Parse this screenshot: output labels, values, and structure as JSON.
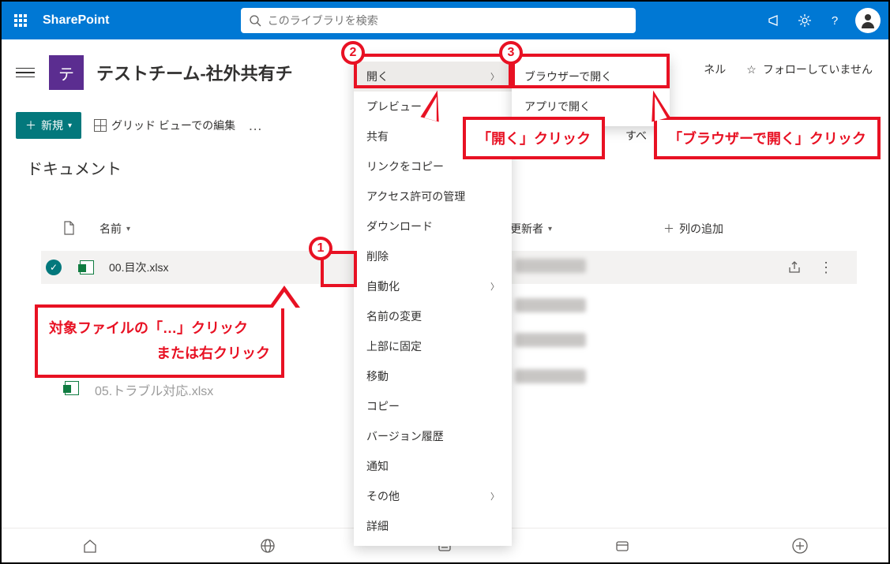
{
  "brand": "SharePoint",
  "search": {
    "placeholder": "このライブラリを検索"
  },
  "site": {
    "icon_letter": "テ",
    "name": "テストチーム-社外共有チ"
  },
  "follow": {
    "panel_suffix_label": "ネル",
    "label": "フォローしていません"
  },
  "toolbar": {
    "new_label": "新規",
    "grid_edit_label": "グリッド ビューでの編集",
    "more": "…"
  },
  "library_title": "ドキュメント",
  "columns": {
    "name": "名前",
    "modified_by": "更新者",
    "add_column": "列の追加"
  },
  "files": [
    {
      "name": "00.目次.xlsx"
    },
    {
      "name": "05.トラブル対応.xlsx"
    }
  ],
  "context_menu": {
    "open": "開く",
    "preview": "プレビュー",
    "share": "共有",
    "copy_link": "リンクをコピー",
    "manage_access": "アクセス許可の管理",
    "download": "ダウンロード",
    "delete": "削除",
    "automate": "自動化",
    "rename": "名前の変更",
    "pin_top": "上部に固定",
    "move": "移動",
    "copy": "コピー",
    "version_history": "バージョン履歴",
    "alert": "通知",
    "other": "その他",
    "details": "詳細"
  },
  "submenu": {
    "open_browser": "ブラウザーで開く",
    "open_app": "アプリで開く",
    "all_suffix": "すべ"
  },
  "steps": {
    "s1": "1",
    "s2": "2",
    "s3": "3"
  },
  "callouts": {
    "c1_line1": "対象ファイルの「…」クリック",
    "c1_line2": "または右クリック",
    "c2": "「開く」クリック",
    "c3": "「ブラウザーで開く」クリック"
  }
}
